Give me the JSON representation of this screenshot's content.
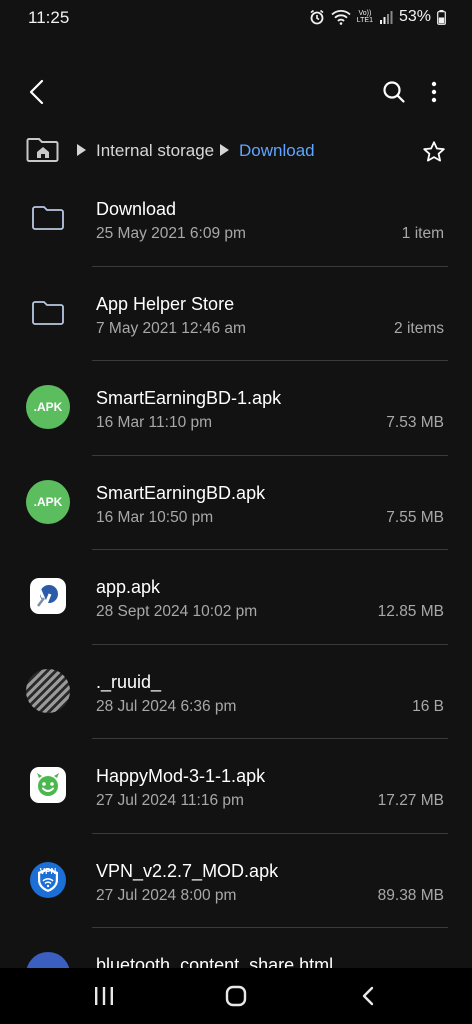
{
  "status_bar": {
    "time": "11:25",
    "network_label": "Vo))\nLTE1",
    "battery_percent": "53%"
  },
  "breadcrumb": {
    "items": [
      "Internal storage",
      "Download"
    ]
  },
  "files": [
    {
      "name": "Download",
      "date": "25 May 2021 6:09 pm",
      "size": "1 item",
      "icon": "folder-icon"
    },
    {
      "name": "App Helper Store",
      "date": "7 May 2021 12:46 am",
      "size": "2 items",
      "icon": "folder-icon"
    },
    {
      "name": "SmartEarningBD-1.apk",
      "date": "16 Mar 11:10 pm",
      "size": "7.53 MB",
      "icon": "apk-icon",
      "badge": ".APK"
    },
    {
      "name": "SmartEarningBD.apk",
      "date": "16 Mar 10:50 pm",
      "size": "7.55 MB",
      "icon": "apk-icon",
      "badge": ".APK"
    },
    {
      "name": "app.apk",
      "date": "28 Sept 2024 10:02 pm",
      "size": "12.85 MB",
      "icon": "app-icon"
    },
    {
      "name": "._ruuid_",
      "date": "28 Jul 2024 6:36 pm",
      "size": "16 B",
      "icon": "unknown-file-icon"
    },
    {
      "name": "HappyMod-3-1-1.apk",
      "date": "27 Jul 2024 11:16 pm",
      "size": "17.27 MB",
      "icon": "happymod-icon"
    },
    {
      "name": "VPN_v2.2.7_MOD.apk",
      "date": "27 Jul 2024 8:00 pm",
      "size": "89.38 MB",
      "icon": "vpn-icon",
      "badge": "VPN"
    },
    {
      "name": "bluetooth_content_share.html",
      "date": "",
      "size": "",
      "icon": "html-file-icon"
    }
  ],
  "colors": {
    "background": "#121212",
    "accent": "#5fa5ff",
    "apk_green": "#5cbd5f",
    "secondary_text": "#a8a8a8"
  }
}
